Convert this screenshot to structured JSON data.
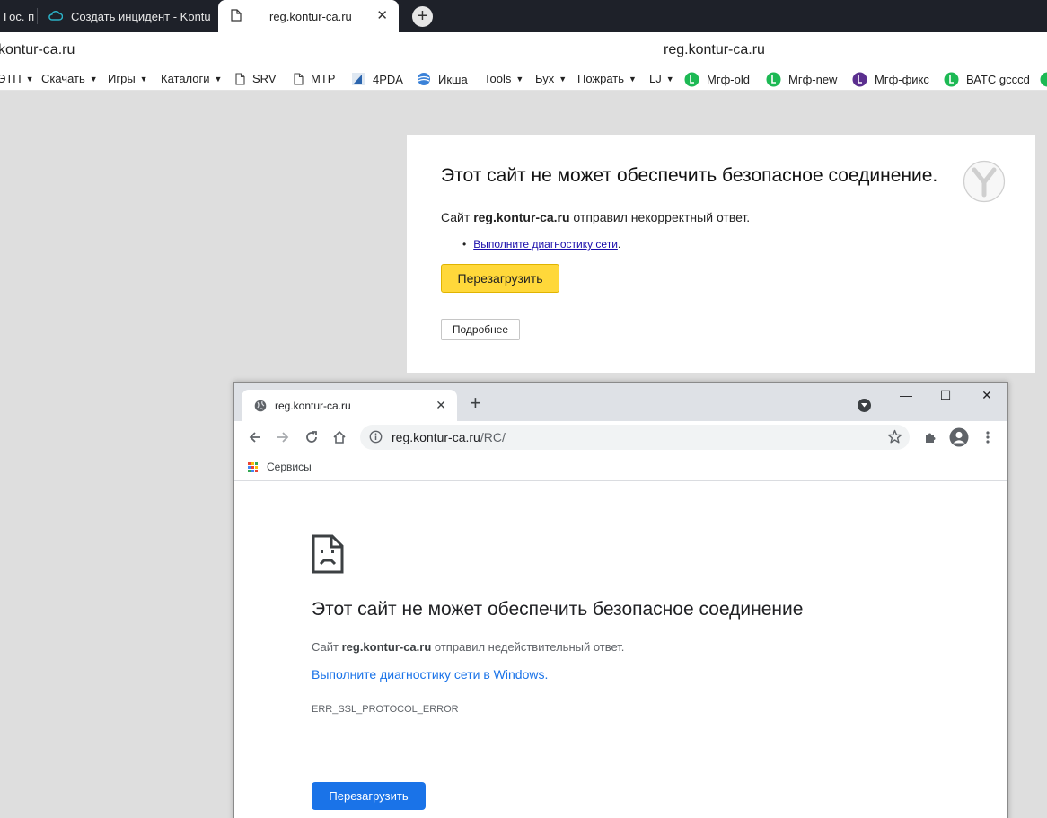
{
  "yandex": {
    "tabs": [
      {
        "title": "Гос. п",
        "icon": "globe-icon"
      },
      {
        "title": "Создать инцидент - Kontu",
        "icon": "cloud-icon"
      },
      {
        "title": "reg.kontur-ca.ru",
        "icon": "page-icon",
        "active": true
      }
    ],
    "new_tab": "+",
    "address_left": "kontur-ca.ru",
    "address_center": "reg.kontur-ca.ru",
    "bookmarks": [
      {
        "label": "ЭТП",
        "dropdown": true
      },
      {
        "label": "Скачать",
        "dropdown": true
      },
      {
        "label": "Игры",
        "dropdown": true
      },
      {
        "label": "Каталоги",
        "dropdown": true
      },
      {
        "label": "SRV",
        "icon": "page-icon"
      },
      {
        "label": "MTP",
        "icon": "page-icon"
      },
      {
        "label": "4PDA",
        "icon": "4pda-icon"
      },
      {
        "label": "Икша",
        "icon": "globe-icon"
      },
      {
        "label": "Tools",
        "dropdown": true
      },
      {
        "label": "Бух",
        "dropdown": true
      },
      {
        "label": "Пожрать",
        "dropdown": true
      },
      {
        "label": "LJ",
        "dropdown": true
      },
      {
        "label": "Мгф-old",
        "icon": "green-circle-icon"
      },
      {
        "label": "Мгф-new",
        "icon": "green-circle-icon"
      },
      {
        "label": "Мгф-фикс",
        "icon": "purple-circle-icon"
      },
      {
        "label": "ВАТС gcccd",
        "icon": "green-circle-icon"
      }
    ],
    "error": {
      "title": "Этот сайт не может обеспечить безопасное соединение.",
      "msg_prefix": "Сайт ",
      "msg_host": "reg.kontur-ca.ru",
      "msg_suffix": " отправил некорректный ответ.",
      "diag_link": "Выполните диагностику сети",
      "diag_period": ".",
      "reload": "Перезагрузить",
      "details": "Подробнее"
    }
  },
  "chrome": {
    "tab_title": "reg.kontur-ca.ru",
    "tab_close": "✕",
    "new_tab": "+",
    "win_controls": {
      "minimize": "—",
      "maximize": "☐",
      "close": "✕"
    },
    "address_host": "reg.kontur-ca.ru",
    "address_path": "/RC/",
    "bookmark": "Сервисы",
    "error": {
      "title": "Этот сайт не может обеспечить безопасное соединение",
      "msg_prefix": "Сайт ",
      "msg_host": "reg.kontur-ca.ru",
      "msg_suffix": " отправил недействительный ответ.",
      "diag_link": "Выполните диагностику сети в Windows.",
      "code": "ERR_SSL_PROTOCOL_ERROR",
      "reload": "Перезагрузить"
    }
  },
  "colors": {
    "yandex_reload": "#ffd83a",
    "chrome_blue": "#1a73e8",
    "yandex_tabbar": "#1e2129"
  }
}
